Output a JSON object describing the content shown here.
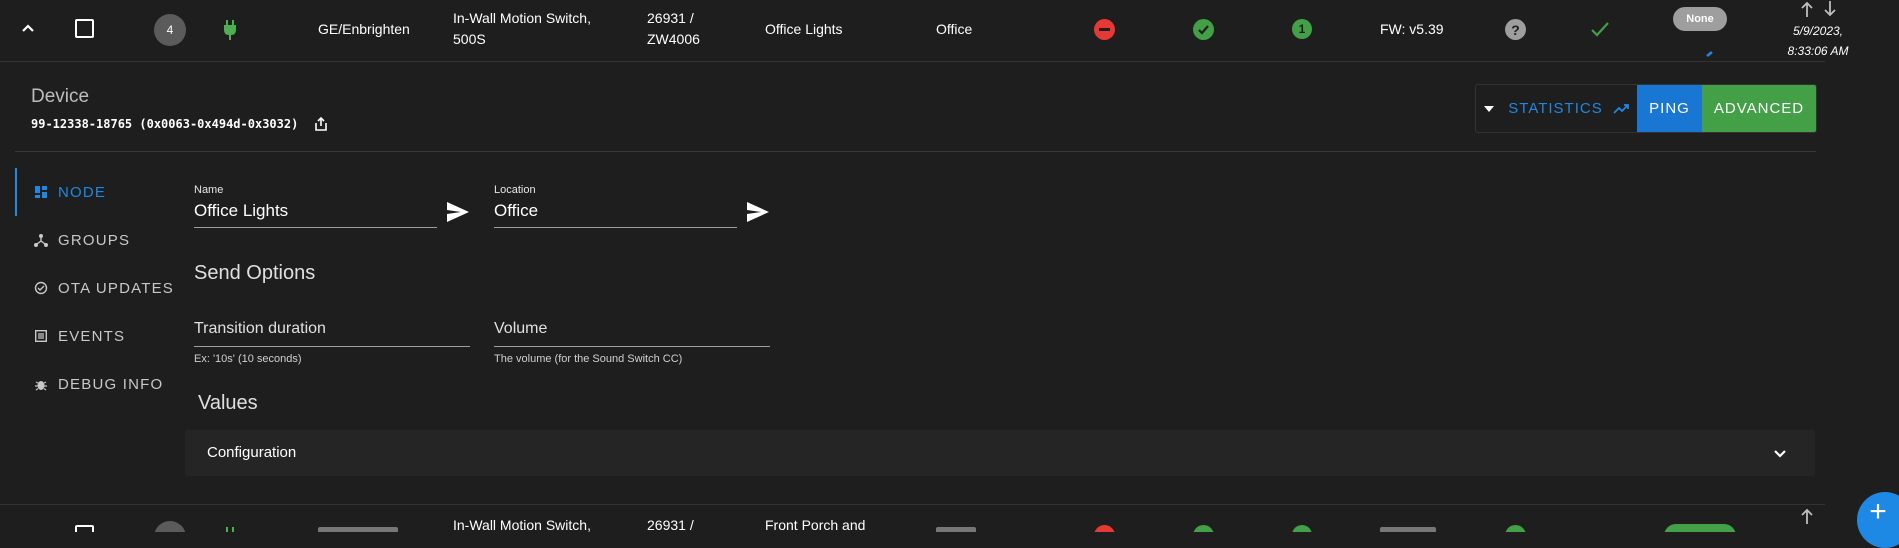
{
  "colors": {
    "background": "#1e1e1e",
    "accent_blue": "#1976d2",
    "accent_green": "#43a047",
    "error_red": "#e53935",
    "success_green": "#43a047",
    "power_green": "#4caf50"
  },
  "row1": {
    "expand_icon": "chevron-up-icon",
    "node_id": "4",
    "power_icon": "plug-icon",
    "manufacturer": "GE/Enbrighten",
    "product_line1": "In-Wall Motion Switch,",
    "product_line2": "500S",
    "product_code_line1": "26931 /",
    "product_code_line2": "ZW4006",
    "name": "Office Lights",
    "location": "Office",
    "security_icon": "minus-circle-icon",
    "status_icon": "check-circle-icon",
    "interview_badge": "1",
    "firmware": "FW: v5.39",
    "help_icon": "question-circle-icon",
    "ready_icon": "check-icon",
    "security_chip": "None",
    "last_active_line1": "5/9/2023,",
    "last_active_line2": "8:33:06 AM"
  },
  "device_panel": {
    "title": "Device",
    "device_id": "99-12338-18765 (0x0063-0x494d-0x3032)",
    "statistics_label": "Statistics",
    "ping_label": "Ping",
    "advanced_label": "Advanced"
  },
  "sidebar": {
    "items": [
      {
        "label": "Node",
        "icon": "dashboard-icon"
      },
      {
        "label": "Groups",
        "icon": "hub-icon"
      },
      {
        "label": "OTA Updates",
        "icon": "sync-icon"
      },
      {
        "label": "Events",
        "icon": "list-icon"
      },
      {
        "label": "Debug Info",
        "icon": "bug-icon"
      }
    ]
  },
  "form": {
    "name_label": "Name",
    "name_value": "Office Lights",
    "location_label": "Location",
    "location_value": "Office",
    "send_options_heading": "Send Options",
    "transition_label": "Transition duration",
    "transition_helper": "Ex: '10s' (10 seconds)",
    "volume_label": "Volume",
    "volume_helper": "The volume (for the Sound Switch CC)",
    "values_heading": "Values",
    "configuration_label": "Configuration"
  },
  "row2": {
    "product_line1": "In-Wall Motion Switch,",
    "product_code_line1": "26931 /",
    "name_line1": "Front Porch and"
  },
  "fab": {
    "label": "+"
  }
}
